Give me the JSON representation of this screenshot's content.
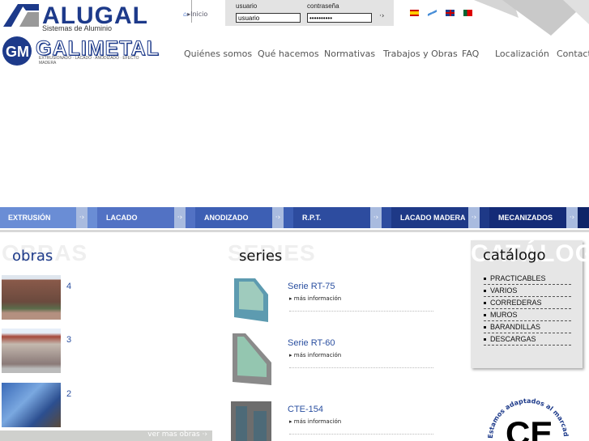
{
  "header": {
    "brand1": "ALUGAL",
    "brand1_sub": "Sistemas de Aluminio",
    "brand2": "GALIMETAL",
    "brand2_sub": "EXTRUSIONADO · LACADO · ANODIZADO · EFECTO MADERA",
    "home": "Inicio"
  },
  "login": {
    "user_label": "usuario",
    "user_value": "usuario",
    "pass_label": "contraseña",
    "pass_value": "••••••••••",
    "submit_icon": "arrow-right-icon"
  },
  "languages": [
    "es",
    "gl",
    "en",
    "pt"
  ],
  "nav": [
    "Quiénes somos",
    "Qué hacemos",
    "Normativas",
    "Trabajos y Obras",
    "FAQ",
    "Localización",
    "Contacto"
  ],
  "categories": [
    {
      "label": "EXTRUSIÓN",
      "color": "#6a8dd5"
    },
    {
      "label": "LACADO",
      "color": "#5272c4"
    },
    {
      "label": "ANODIZADO",
      "color": "#3d5fb4"
    },
    {
      "label": "R.P.T.",
      "color": "#2d4c9f"
    },
    {
      "label": "LACADO MADERA",
      "color": "#1e3987"
    },
    {
      "label": "MECANIZADOS",
      "color": "#142b77"
    }
  ],
  "obras": {
    "ghost": "OBRAS",
    "title": "obras",
    "items": [
      "4",
      "3",
      "2"
    ],
    "more": "ver mas obras ·›"
  },
  "series": {
    "ghost": "SERIES",
    "title": "series",
    "more_label": "más información",
    "items": [
      "Serie RT-75",
      "Serie RT-60",
      "CTE-154"
    ]
  },
  "catalogo": {
    "ghost": "CATÁLOGO",
    "title": "catálogo",
    "items": [
      "PRACTICABLES",
      "VARIOS",
      "CORREDERAS",
      "MUROS",
      "BARANDILLAS",
      "DESCARGAS"
    ]
  },
  "ce": {
    "text": "Estamos adaptados al marcado",
    "mark": "CE"
  }
}
